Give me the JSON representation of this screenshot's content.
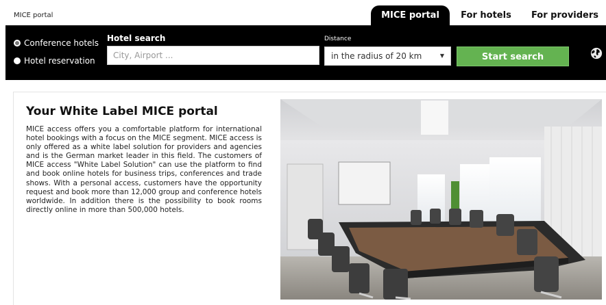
{
  "header": {
    "site_label": "MICE portal",
    "tabs": [
      {
        "label": "MICE portal",
        "active": true
      },
      {
        "label": "For hotels",
        "active": false
      },
      {
        "label": "For providers",
        "active": false
      }
    ]
  },
  "search": {
    "search_type_options": [
      {
        "label": "Conference hotels",
        "checked": true
      },
      {
        "label": "Hotel reservation",
        "checked": false
      }
    ],
    "hotel_search_label": "Hotel search",
    "hotel_search_placeholder": "City, Airport ...",
    "distance_label": "Distance",
    "distance_value": "in the radius of 20 km",
    "start_button": "Start search",
    "language_icon": "globe-icon"
  },
  "content": {
    "title": "Your White Label MICE portal",
    "paragraph": "MICE access offers you a comfortable platform for international hotel bookings with a focus on the MICE segment. MICE access is only offered as a white label solution for providers and agencies and is the German market leader in this field. The customers of MICE access \"White Label Solution\" can use the platform to find and book online hotels for business trips, conferences and trade shows. With a personal access, customers have the opportunity request and book more than 12,000 group and conference hotels worldwide. In addition there is the possibility to book rooms directly online in more than 500,000 hotels.",
    "image_subject": "conference-room-photo"
  },
  "colors": {
    "header_band": "#000000",
    "start_button": "#64b351",
    "active_tab": "#000000"
  }
}
